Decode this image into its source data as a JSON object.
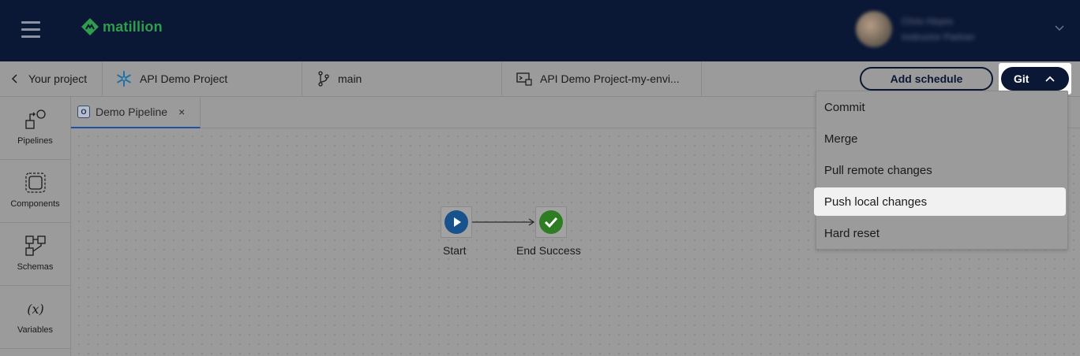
{
  "header": {
    "logo_text": "matillion",
    "brand_color": "#2f9e4c",
    "bg_color": "#0a1735",
    "user_name": "Chris Heyes",
    "user_role": "Instructor Partner"
  },
  "context_bar": {
    "back_label": "Your project",
    "project_label": "API Demo Project",
    "branch_label": "main",
    "environment_label": "API Demo Project-my-envi..."
  },
  "actions": {
    "add_schedule_label": "Add schedule",
    "git_label": "Git"
  },
  "sidebar": {
    "items": [
      {
        "label": "Pipelines",
        "icon": "pipelines-icon"
      },
      {
        "label": "Components",
        "icon": "components-icon"
      },
      {
        "label": "Schemas",
        "icon": "schemas-icon"
      },
      {
        "label": "Variables",
        "icon": "variables-icon"
      }
    ]
  },
  "tabs": [
    {
      "label": "Demo Pipeline",
      "icon_letter": "O",
      "close": "×"
    }
  ],
  "canvas": {
    "nodes": [
      {
        "label": "Start",
        "icon": "play-icon"
      },
      {
        "label": "End Success",
        "icon": "check-icon"
      }
    ]
  },
  "git_menu": {
    "items": [
      {
        "label": "Commit"
      },
      {
        "label": "Merge"
      },
      {
        "label": "Pull remote changes"
      },
      {
        "label": "Push local changes",
        "highlighted": true
      },
      {
        "label": "Hard reset"
      }
    ]
  }
}
